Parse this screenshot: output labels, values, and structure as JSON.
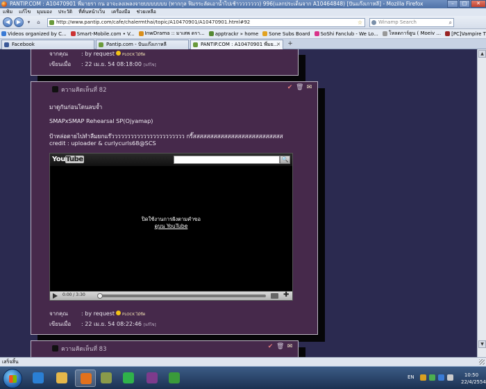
{
  "window": {
    "title": "PANTIP.COM : A10470901 พี่มายรา กน อาจะลงเพลงจายบบบบบบบ (ทากกุล ฟิมรระลัดเอาน้ำไปเช้าววววววว) 996(แลกประเด็นจาก A10464848) [ปันแก๊งเกาหลี] - Mozilla Firefox",
    "controls": [
      "–",
      "□",
      "✕"
    ]
  },
  "menu": [
    "แฟ้ม",
    "แก้ไข",
    "มุมมอง",
    "ประวัติ",
    "ที่คั่นหน้าเว็บ",
    "เครื่องมือ",
    "ช่วยเหลือ"
  ],
  "nav": {
    "back": "◀",
    "forward": "▶",
    "dropdown": "▾",
    "home": "⌂",
    "url": "http://www.pantip.com/cafe/chalermthai/topic/A10470901/A10470901.html#92",
    "search_placeholder": "Winamp Search"
  },
  "bookmarks": [
    {
      "label": "Videos organized by C...",
      "color": "#3a7bd5"
    },
    {
      "label": "Smart-Mobile.com • V...",
      "color": "#cc3333"
    },
    {
      "label": "InwDrama :: มาเสพ ดรา...",
      "color": "#d98f1c"
    },
    {
      "label": "apptrackr » home",
      "color": "#558833"
    },
    {
      "label": "Sone Subs Board",
      "color": "#e2a322"
    },
    {
      "label": "SoShi Fanclub - We Lo...",
      "color": "#d9338a"
    },
    {
      "label": "โหลดการ์ตูน ( Moeiv ...",
      "color": "#999999"
    },
    {
      "label": "[PC]Vampire The Mas...",
      "color": "#992222"
    }
  ],
  "tabs": [
    {
      "label": "Facebook",
      "color": "#3b5998",
      "close": ""
    },
    {
      "label": "Pantip.com - ปันแก๊งเกาหลี",
      "color": "#6a9a3a",
      "close": ""
    },
    {
      "label": "PANTIP.COM : A10470901 พี่มย...",
      "color": "#6a9a3a",
      "close": "✕"
    }
  ],
  "new_tab": "+",
  "posts": {
    "prev": {
      "from_label": "จากคุณ",
      "from_value": ": by request",
      "badge": "PLOCK ไม้ขีด",
      "time_label": "เขียนเมื่อ",
      "time_value": ": 22 เม.ย. 54 08:18:00",
      "edit": "[แก้ไข]"
    },
    "main": {
      "header": "ความคิดเห็นที่ 82",
      "icons": [
        "✔",
        "🗑",
        "✉"
      ],
      "lines": [
        "มาดูกันก่อนโดนลบจ้ำ",
        "SMAPxSMAP Rehearsal SP(Ojyamap)",
        "ป้าหล่อตายไปทำลืมยกแร๊ววววววววววววววววววววววว กรี๊สสสสสสสสสสสสสสสสสสสสสสสสสส",
        "credit : uploader & curlycurls68@SCS"
      ],
      "from_label": "จากคุณ",
      "from_value": ": by request",
      "badge": "PLOCK ไม้ขีด",
      "time_label": "เขียนเมื่อ",
      "time_value": ": 22 เม.ย. 54 08:22:46",
      "edit": "[แก้ไข]"
    },
    "next": {
      "header": "ความคิดเห็นที่ 83",
      "icons": [
        "✔",
        "🗑",
        "✉"
      ]
    }
  },
  "player": {
    "logo_you": "You",
    "logo_tube": "Tube",
    "search_button": "🔍",
    "message_line1": "ปิดใช้งานการฝังตามคำขอ",
    "message_line2": "ดูบน YouTube",
    "time": "0:00 / 3:30",
    "fullscreen": "✚",
    "progress": 0
  },
  "scroll": {
    "up": "▲",
    "down": "▼"
  },
  "status": "เสร็จสิ้น",
  "taskbar": {
    "apps": [
      {
        "name": "ie",
        "color": "#2a7fd4"
      },
      {
        "name": "folder",
        "color": "#e5b74a"
      },
      {
        "name": "firefox",
        "color": "#e2711d"
      },
      {
        "name": "winamp",
        "color": "#8a9a4a"
      },
      {
        "name": "media",
        "color": "#2fb24a"
      },
      {
        "name": "torrent",
        "color": "#7d3b8c"
      },
      {
        "name": "messenger",
        "color": "#3a9a3a"
      }
    ],
    "lang": "EN",
    "tray_colors": [
      "#d9a020",
      "#4caf50",
      "#3a7bd5",
      "#cccccc"
    ],
    "time": "10:50",
    "date": "22/4/2554"
  }
}
